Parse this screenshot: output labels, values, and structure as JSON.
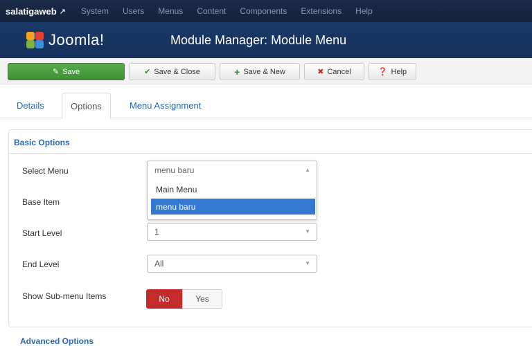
{
  "topnav": {
    "site": "salatigaweb",
    "site_icon": "external-link-icon",
    "items": [
      "System",
      "Users",
      "Menus",
      "Content",
      "Components",
      "Extensions",
      "Help"
    ]
  },
  "header": {
    "logo_text": "Joomla!",
    "title": "Module Manager: Module Menu"
  },
  "toolbar": {
    "save": "Save",
    "save_close": "Save & Close",
    "save_new": "Save & New",
    "cancel": "Cancel",
    "help": "Help"
  },
  "tabs": [
    "Details",
    "Options",
    "Menu Assignment"
  ],
  "active_tab": "Options",
  "basic_options": {
    "legend": "Basic Options",
    "select_menu": {
      "label": "Select Menu",
      "value": "menu baru",
      "options": [
        "Main Menu",
        "menu baru"
      ],
      "selected": "menu baru"
    },
    "base_item": {
      "label": "Base Item"
    },
    "start_level": {
      "label": "Start Level",
      "value": "1"
    },
    "end_level": {
      "label": "End Level",
      "value": "All"
    },
    "show_submenu": {
      "label": "Show Sub-menu Items",
      "no": "No",
      "yes": "Yes",
      "selected": "No"
    }
  },
  "advanced_options": {
    "legend": "Advanced Options"
  },
  "colors": {
    "topnav_bg": "#14213a",
    "header_bg": "#17315c",
    "save_green": "#46963c",
    "link_blue": "#2a69b8",
    "toggle_red": "#c42b2b",
    "selection_blue": "#3478d4"
  }
}
